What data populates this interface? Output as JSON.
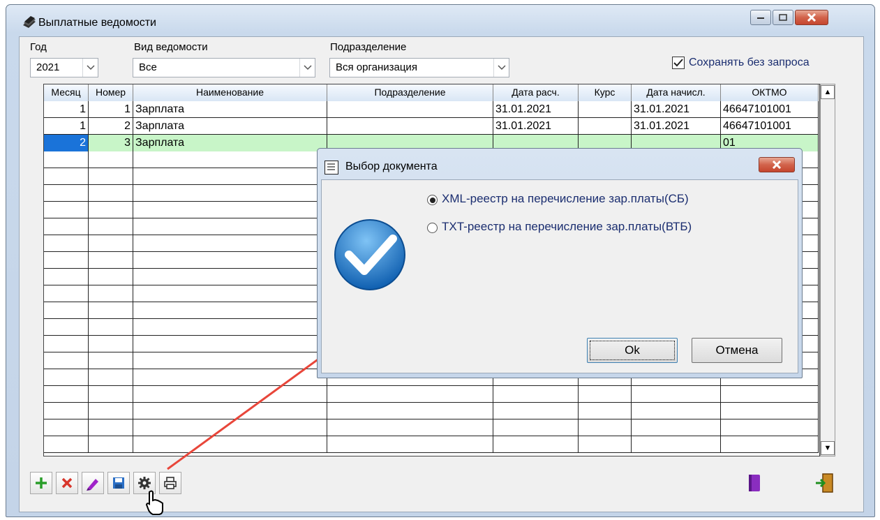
{
  "window": {
    "title": "Выплатные ведомости"
  },
  "filters": {
    "year": {
      "label": "Год",
      "value": "2021"
    },
    "type": {
      "label": "Вид ведомости",
      "value": "Все"
    },
    "dept": {
      "label": "Подразделение",
      "value": "Вся организация"
    },
    "save_without_prompt": {
      "label": "Сохранять без запроса",
      "checked": true
    }
  },
  "table": {
    "columns": [
      "Месяц",
      "Номер",
      "Наименование",
      "Подразделение",
      "Дата расч.",
      "Курс",
      "Дата начисл.",
      "ОКТМО"
    ],
    "rows": [
      [
        "1",
        "1",
        "Зарплата",
        "",
        "31.01.2021",
        "",
        "31.01.2021",
        "46647101001"
      ],
      [
        "1",
        "2",
        "Зарплата",
        "",
        "31.01.2021",
        "",
        "31.01.2021",
        "46647101001"
      ],
      [
        "2",
        "3",
        "Зарплата",
        "",
        "",
        "",
        "",
        "01"
      ]
    ]
  },
  "dialog": {
    "title": "Выбор документа",
    "options": [
      {
        "label": "XML-реестр на перечисление зар.платы(СБ)",
        "selected": true
      },
      {
        "label": "TXT-реестр на перечисление зар.платы(ВТБ)",
        "selected": false
      }
    ],
    "ok_label": "Ok",
    "cancel_label": "Отмена"
  },
  "colors": {
    "selected_cell": "#1a73d9",
    "selected_row": "#c8f5c8",
    "link_text": "#1b2e70",
    "arrow": "#e8463a"
  }
}
